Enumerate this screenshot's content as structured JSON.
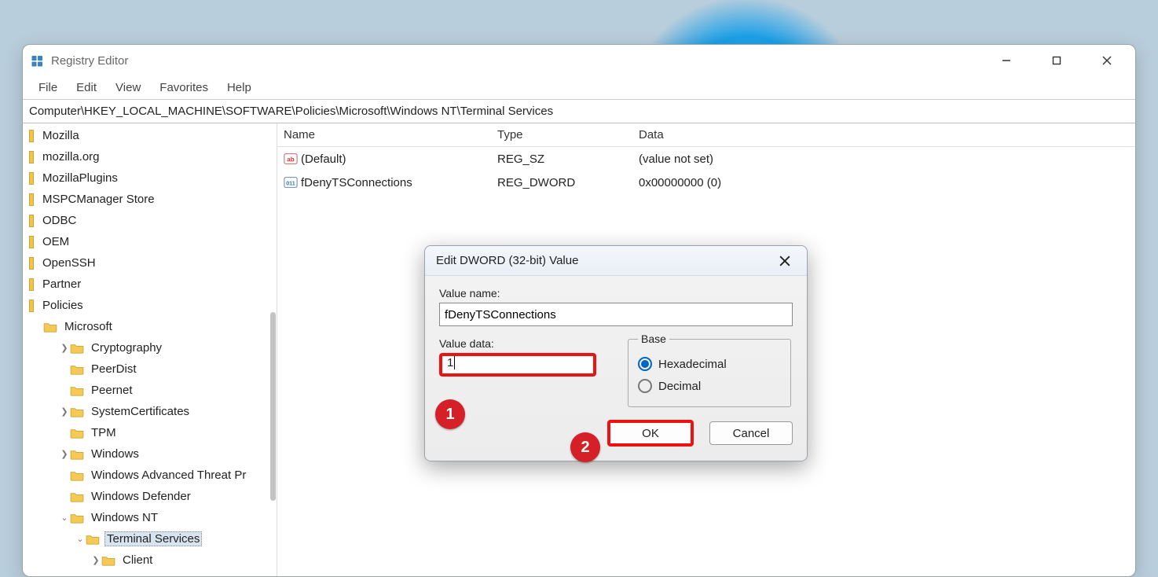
{
  "app": {
    "title": "Registry Editor"
  },
  "menu": {
    "file": "File",
    "edit": "Edit",
    "view": "View",
    "favorites": "Favorites",
    "help": "Help"
  },
  "address": "Computer\\HKEY_LOCAL_MACHINE\\SOFTWARE\\Policies\\Microsoft\\Windows NT\\Terminal Services",
  "tree": {
    "mozilla": "Mozilla",
    "mozillaorg": "mozilla.org",
    "mozillaplugins": "MozillaPlugins",
    "mspc": "MSPCManager Store",
    "odbc": "ODBC",
    "oem": "OEM",
    "openssh": "OpenSSH",
    "partner": "Partner",
    "policies": "Policies",
    "microsoft": "Microsoft",
    "crypto": "Cryptography",
    "peerdist": "PeerDist",
    "peernet": "Peernet",
    "syscerts": "SystemCertificates",
    "tpm": "TPM",
    "windows": "Windows",
    "watp": "Windows Advanced Threat Pr",
    "defender": "Windows Defender",
    "winnt": "Windows NT",
    "terminal": "Terminal Services",
    "client": "Client"
  },
  "list": {
    "headers": {
      "name": "Name",
      "type": "Type",
      "data": "Data"
    },
    "rows": [
      {
        "name": "(Default)",
        "type": "REG_SZ",
        "data": "(value not set)",
        "kind": "sz"
      },
      {
        "name": "fDenyTSConnections",
        "type": "REG_DWORD",
        "data": "0x00000000 (0)",
        "kind": "dw"
      }
    ]
  },
  "dialog": {
    "title": "Edit DWORD (32-bit) Value",
    "value_name_label": "Value name:",
    "value_name": "fDenyTSConnections",
    "value_data_label": "Value data:",
    "value_data": "1",
    "base_label": "Base",
    "hex": "Hexadecimal",
    "dec": "Decimal",
    "ok": "OK",
    "cancel": "Cancel"
  },
  "callouts": {
    "one": "1",
    "two": "2"
  }
}
